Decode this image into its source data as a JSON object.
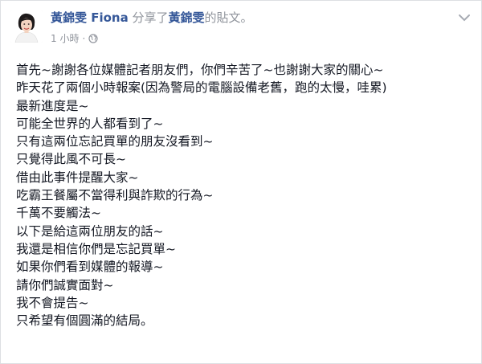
{
  "post": {
    "author": "黃錦雯 Fiona",
    "shared_text": "分享了",
    "source_author": "黃錦雯",
    "source_suffix": "的貼文。",
    "timestamp": "1 小時",
    "separator": "·",
    "privacy_icon": "globe-icon",
    "menu_icon": "chevron-down-icon",
    "avatar_icon": "avatar-photo",
    "lines": [
      "首先~謝謝各位媒體記者朋友們，你們辛苦了~也謝謝大家的關心~",
      "昨天花了兩個小時報案(因為警局的電腦設備老舊，跑的太慢，哇累)",
      "最新進度是~",
      "可能全世界的人都看到了~",
      "只有這兩位忘記買單的朋友沒看到~",
      "只覺得此風不可長~",
      "借由此事件提醒大家~",
      "吃霸王餐屬不當得利與詐欺的行為~",
      "千萬不要觸法~",
      "以下是給這兩位朋友的話~",
      "我還是相信你們是忘記買單~",
      "如果你們看到媒體的報導~",
      "請你們誠實面對~",
      "我不會提告~",
      "只希望有個圓滿的結局。"
    ]
  },
  "colors": {
    "link": "#365899",
    "meta": "#90949c",
    "text": "#141823"
  }
}
